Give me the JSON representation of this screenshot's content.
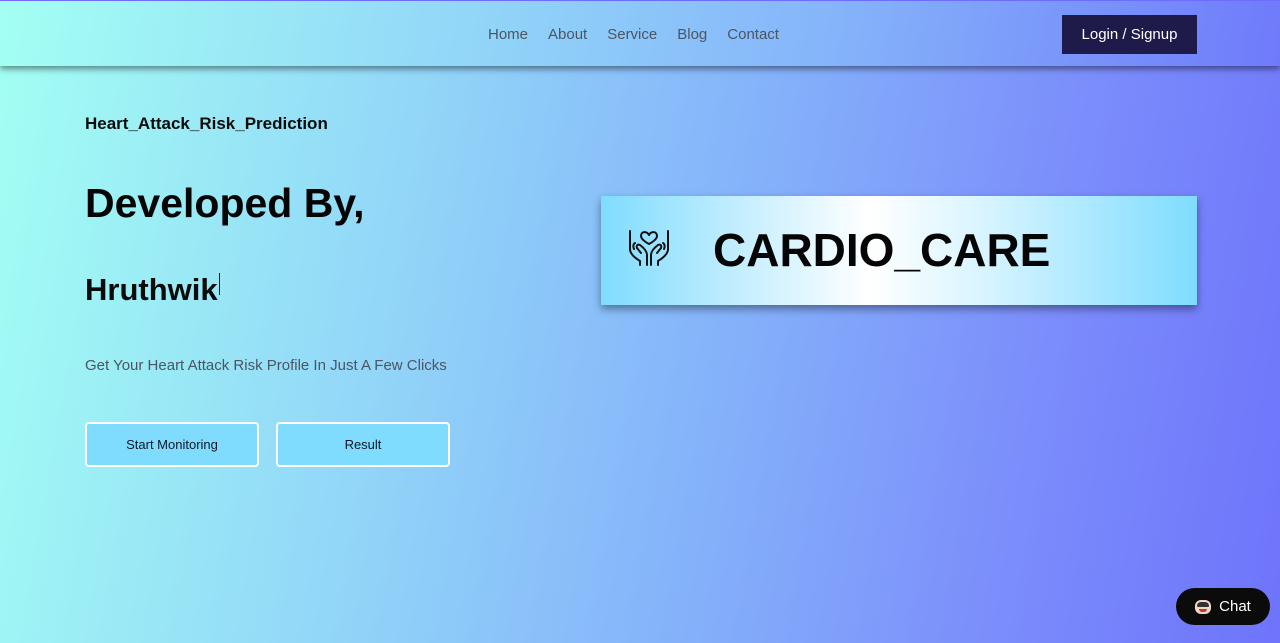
{
  "nav": {
    "links": [
      "Home",
      "About",
      "Service",
      "Blog",
      "Contact"
    ],
    "login_label": "Login / Signup"
  },
  "hero": {
    "project_name": "Heart_Attack_Risk_Prediction",
    "heading": "Developed By,",
    "developer": "Hruthwik",
    "tagline": "Get Your Heart Attack Risk Profile In Just A Few Clicks",
    "start_label": "Start Monitoring",
    "result_label": "Result"
  },
  "brand": {
    "title": "CARDIO_CARE",
    "icon": "heart-hands-icon"
  },
  "chat": {
    "label": "Chat",
    "icon": "chat-avatar-icon"
  },
  "colors": {
    "nav_button": "#1e1b4b",
    "cta_fill": "#7fdcff",
    "gradient_start": "#a3fff3",
    "gradient_end": "#6e74fb"
  }
}
